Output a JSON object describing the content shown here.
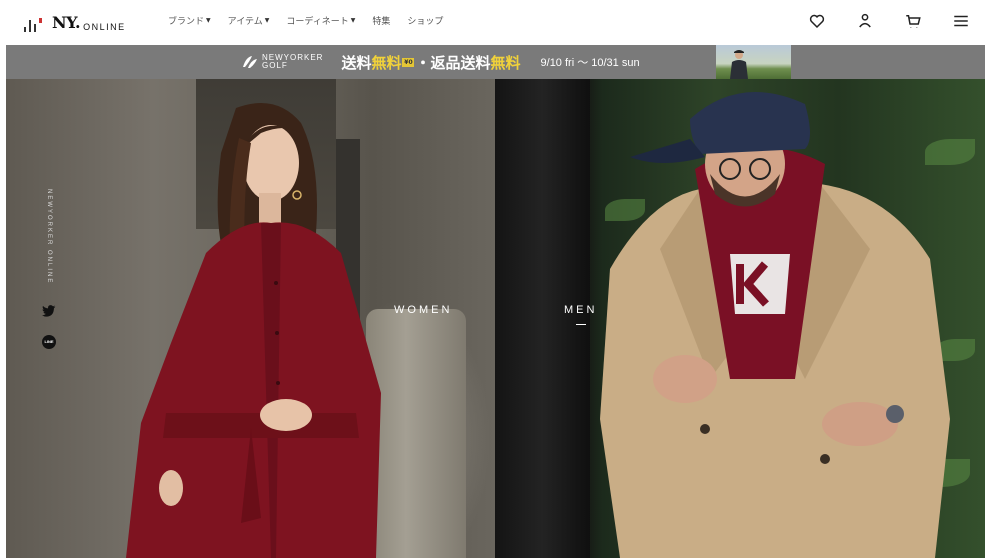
{
  "header": {
    "logo_text": "NY.",
    "logo_sub": "ONLINE",
    "nav": [
      {
        "label": "ブランド",
        "dropdown": true
      },
      {
        "label": "アイテム",
        "dropdown": true
      },
      {
        "label": "コーディネート",
        "dropdown": true
      },
      {
        "label": "特集",
        "dropdown": false
      },
      {
        "label": "ショップ",
        "dropdown": false
      }
    ],
    "icons": [
      "heart-icon",
      "user-icon",
      "cart-icon",
      "menu-icon"
    ]
  },
  "banner": {
    "brand_line1": "NEWYORKER",
    "brand_line2": "GOLF",
    "promo_part1": "送料",
    "promo_part2": "無料",
    "promo_badge": "¥0",
    "promo_part3": "・返品送料",
    "promo_part4": "無料",
    "date_range": "9/10 fri ～ 10/31 sun",
    "bg_color": "#7a7a7a",
    "accent_color": "#f1d23a"
  },
  "hero": {
    "women_label": "WOMEN",
    "men_label": "MEN",
    "vertical_text": "NEWYORKER ONLINE"
  },
  "social": {
    "line_label": "LINE"
  }
}
